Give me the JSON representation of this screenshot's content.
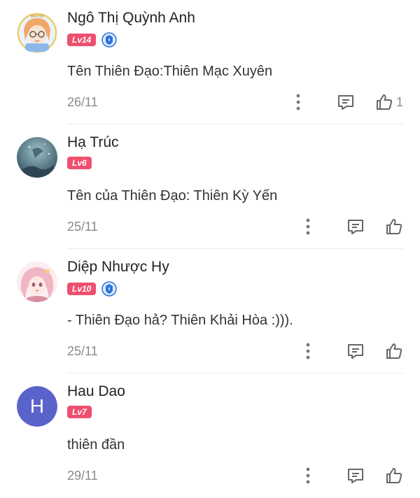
{
  "colors": {
    "level_badge": "#ef4f6f",
    "vip_badge": "#2a73d8",
    "letter_avatar": "#5a63c9",
    "meta_text": "#8a8a8a"
  },
  "comments": [
    {
      "name": "Ngô Thị Quỳnh Anh",
      "level": "Lv14",
      "vip": true,
      "avatar": "anime-girl-glasses-avatar",
      "text": "Tên Thiên Đạo:Thiên Mạc Xuyên",
      "date": "26/11",
      "likes": "1"
    },
    {
      "name": "Hạ Trúc",
      "level": "Lv6",
      "vip": false,
      "avatar": "underwater-scene-avatar",
      "text": "Tên của Thiên Đạo: Thiên Kỳ Yến",
      "date": "25/11",
      "likes": ""
    },
    {
      "name": "Diệp Nhược Hy",
      "level": "Lv10",
      "vip": true,
      "avatar": "pink-hair-anime-avatar",
      "text": "- Thiên Đạo hả? Thiên Khải Hòa :))).",
      "date": "25/11",
      "likes": ""
    },
    {
      "name": "Hau Dao",
      "level": "Lv7",
      "vip": false,
      "avatar_letter": "H",
      "text": "thiên đần",
      "date": "29/11",
      "likes": ""
    }
  ]
}
